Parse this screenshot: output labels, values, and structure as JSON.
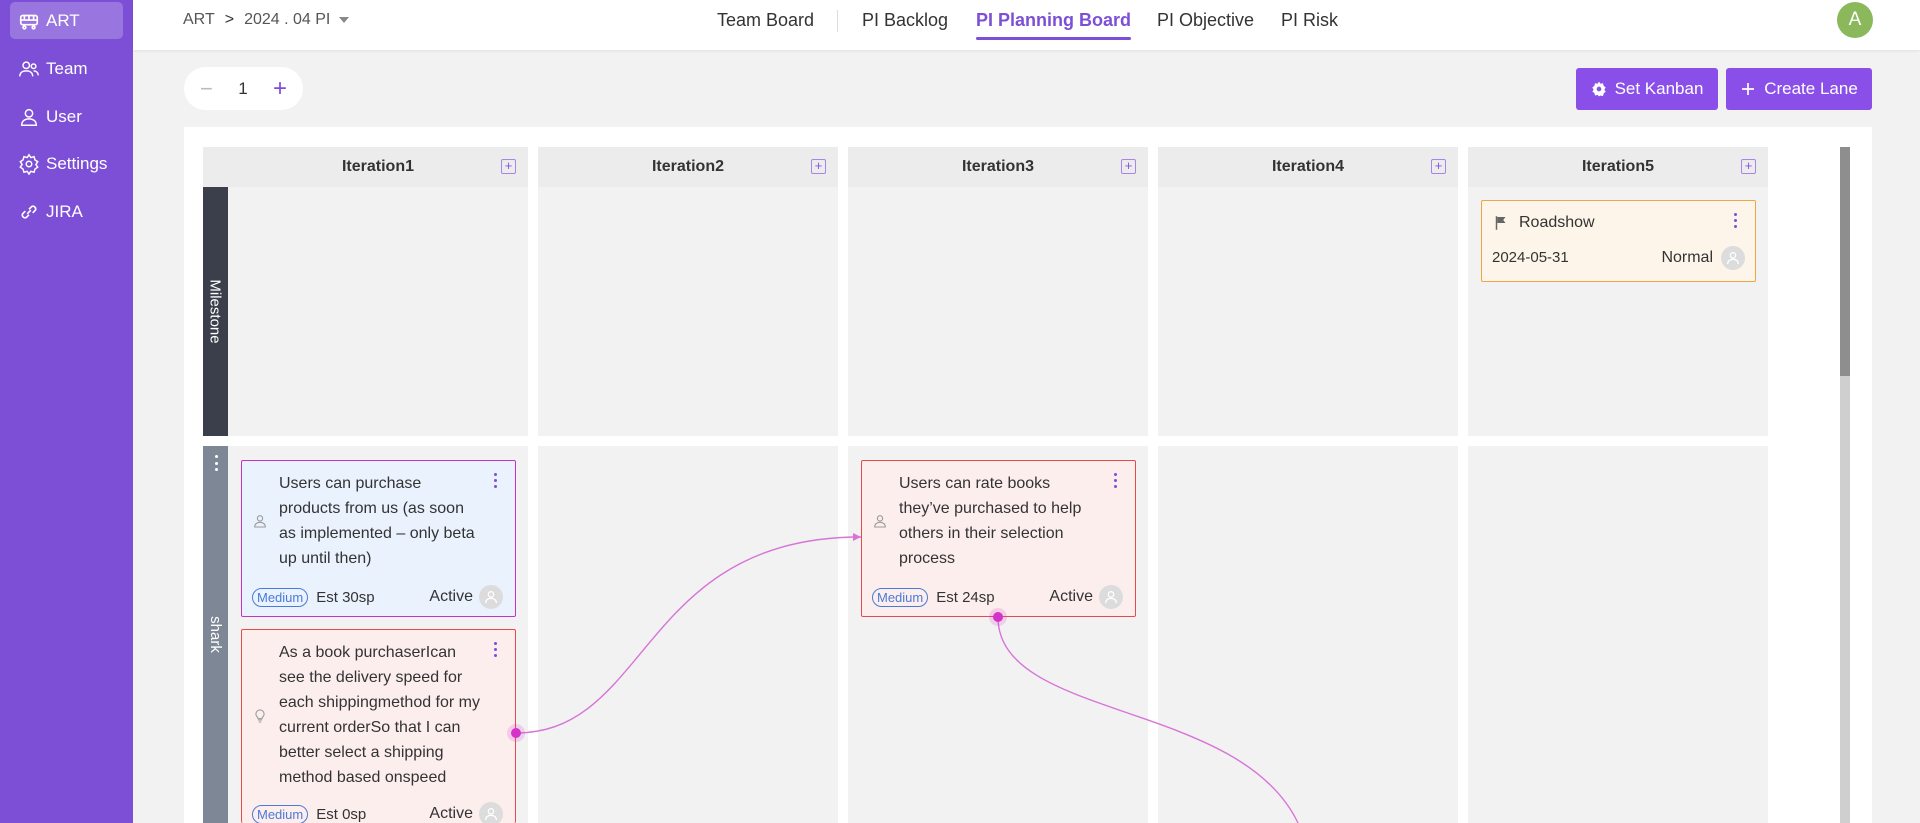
{
  "sidebar": {
    "items": [
      {
        "label": "ART",
        "icon": "train-icon",
        "active": true
      },
      {
        "label": "Team",
        "icon": "team-icon"
      },
      {
        "label": "User",
        "icon": "user-icon"
      },
      {
        "label": "Settings",
        "icon": "gear-icon"
      },
      {
        "label": "JIRA",
        "icon": "link-icon"
      }
    ]
  },
  "header": {
    "breadcrumb": {
      "root": "ART",
      "separator": ">",
      "current": "2024 . 04 PI"
    },
    "tabs": [
      {
        "label": "Team Board"
      },
      {
        "label": "PI Backlog"
      },
      {
        "label": "PI Planning Board",
        "active": true
      },
      {
        "label": "PI Objective"
      },
      {
        "label": "PI Risk"
      }
    ],
    "avatar_initial": "A"
  },
  "toolbar": {
    "stepper_value": "1",
    "minus": "−",
    "plus": "+",
    "set_kanban_label": "Set Kanban",
    "create_lane_label": "Create Lane"
  },
  "board": {
    "columns": [
      {
        "label": "Iteration1"
      },
      {
        "label": "Iteration2"
      },
      {
        "label": "Iteration3"
      },
      {
        "label": "Iteration4"
      },
      {
        "label": "Iteration5"
      }
    ],
    "add_icon": "+",
    "lanes": [
      {
        "label": "Milestone"
      },
      {
        "label": "shark"
      }
    ],
    "milestone_card": {
      "title": "Roadshow",
      "date": "2024-05-31",
      "priority": "Normal"
    },
    "cards": [
      {
        "title": "Users can purchase products from us (as soon as implemented – only beta up until then)",
        "tag": "Medium",
        "estimate": "Est 30sp",
        "status": "Active",
        "type_icon": "user-story-icon"
      },
      {
        "title": "As a book purchaserIcan see the delivery speed for each shippingmethod for my current orderSo that I can better select a shipping method based onspeed",
        "tag": "Medium",
        "estimate": "Est 0sp",
        "status": "Active",
        "type_icon": "lightbulb-icon"
      },
      {
        "title": "Users can rate books they’ve purchased to help others in their selection process",
        "tag": "Medium",
        "estimate": "Est 24sp",
        "status": "Active",
        "type_icon": "user-story-icon"
      }
    ]
  },
  "colors": {
    "sidebar": "#7d4fd6",
    "accent": "#8a4fe8",
    "link": "#d533c7",
    "milestone_lane": "#3a3f4b",
    "shark_lane": "#7e8795"
  }
}
